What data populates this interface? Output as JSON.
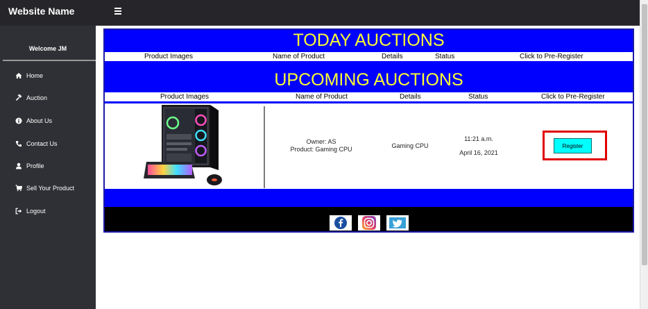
{
  "header": {
    "site_name": "Website Name",
    "menu_icon": "hamburger-menu-icon"
  },
  "sidebar": {
    "welcome": "Welcome JM",
    "items": [
      {
        "label": "Home",
        "icon": "home-icon"
      },
      {
        "label": "Auction",
        "icon": "gavel-icon"
      },
      {
        "label": "About Us",
        "icon": "info-icon"
      },
      {
        "label": "Contact Us",
        "icon": "phone-icon"
      },
      {
        "label": "Profile",
        "icon": "user-icon"
      },
      {
        "label": "Sell Your Product",
        "icon": "cart-icon"
      },
      {
        "label": "Logout",
        "icon": "logout-icon"
      }
    ]
  },
  "today": {
    "title": "TODAY AUCTIONS",
    "columns": [
      "Product Images",
      "Name of Product",
      "Details",
      "Status",
      "Click to Pre-Register"
    ]
  },
  "upcoming": {
    "title": "UPCOMING AUCTIONS",
    "columns": [
      "Product Images",
      "Name of Product",
      "Details",
      "Status",
      "Click to Pre-Register"
    ],
    "rows": [
      {
        "image": "gaming-pc-image",
        "owner": "Owner: AS",
        "product": "Product: Gaming CPU",
        "details": "Gaming CPU",
        "time": "11:21 a.m.",
        "date": "April 16, 2021",
        "button": "Register"
      }
    ]
  },
  "footer": {
    "social": [
      "facebook-icon",
      "instagram-icon",
      "twitter-icon"
    ]
  },
  "colors": {
    "banner_blue": "#0000ff",
    "banner_text": "#ffff33",
    "register_button": "#00ffff",
    "highlight": "#e10000"
  }
}
